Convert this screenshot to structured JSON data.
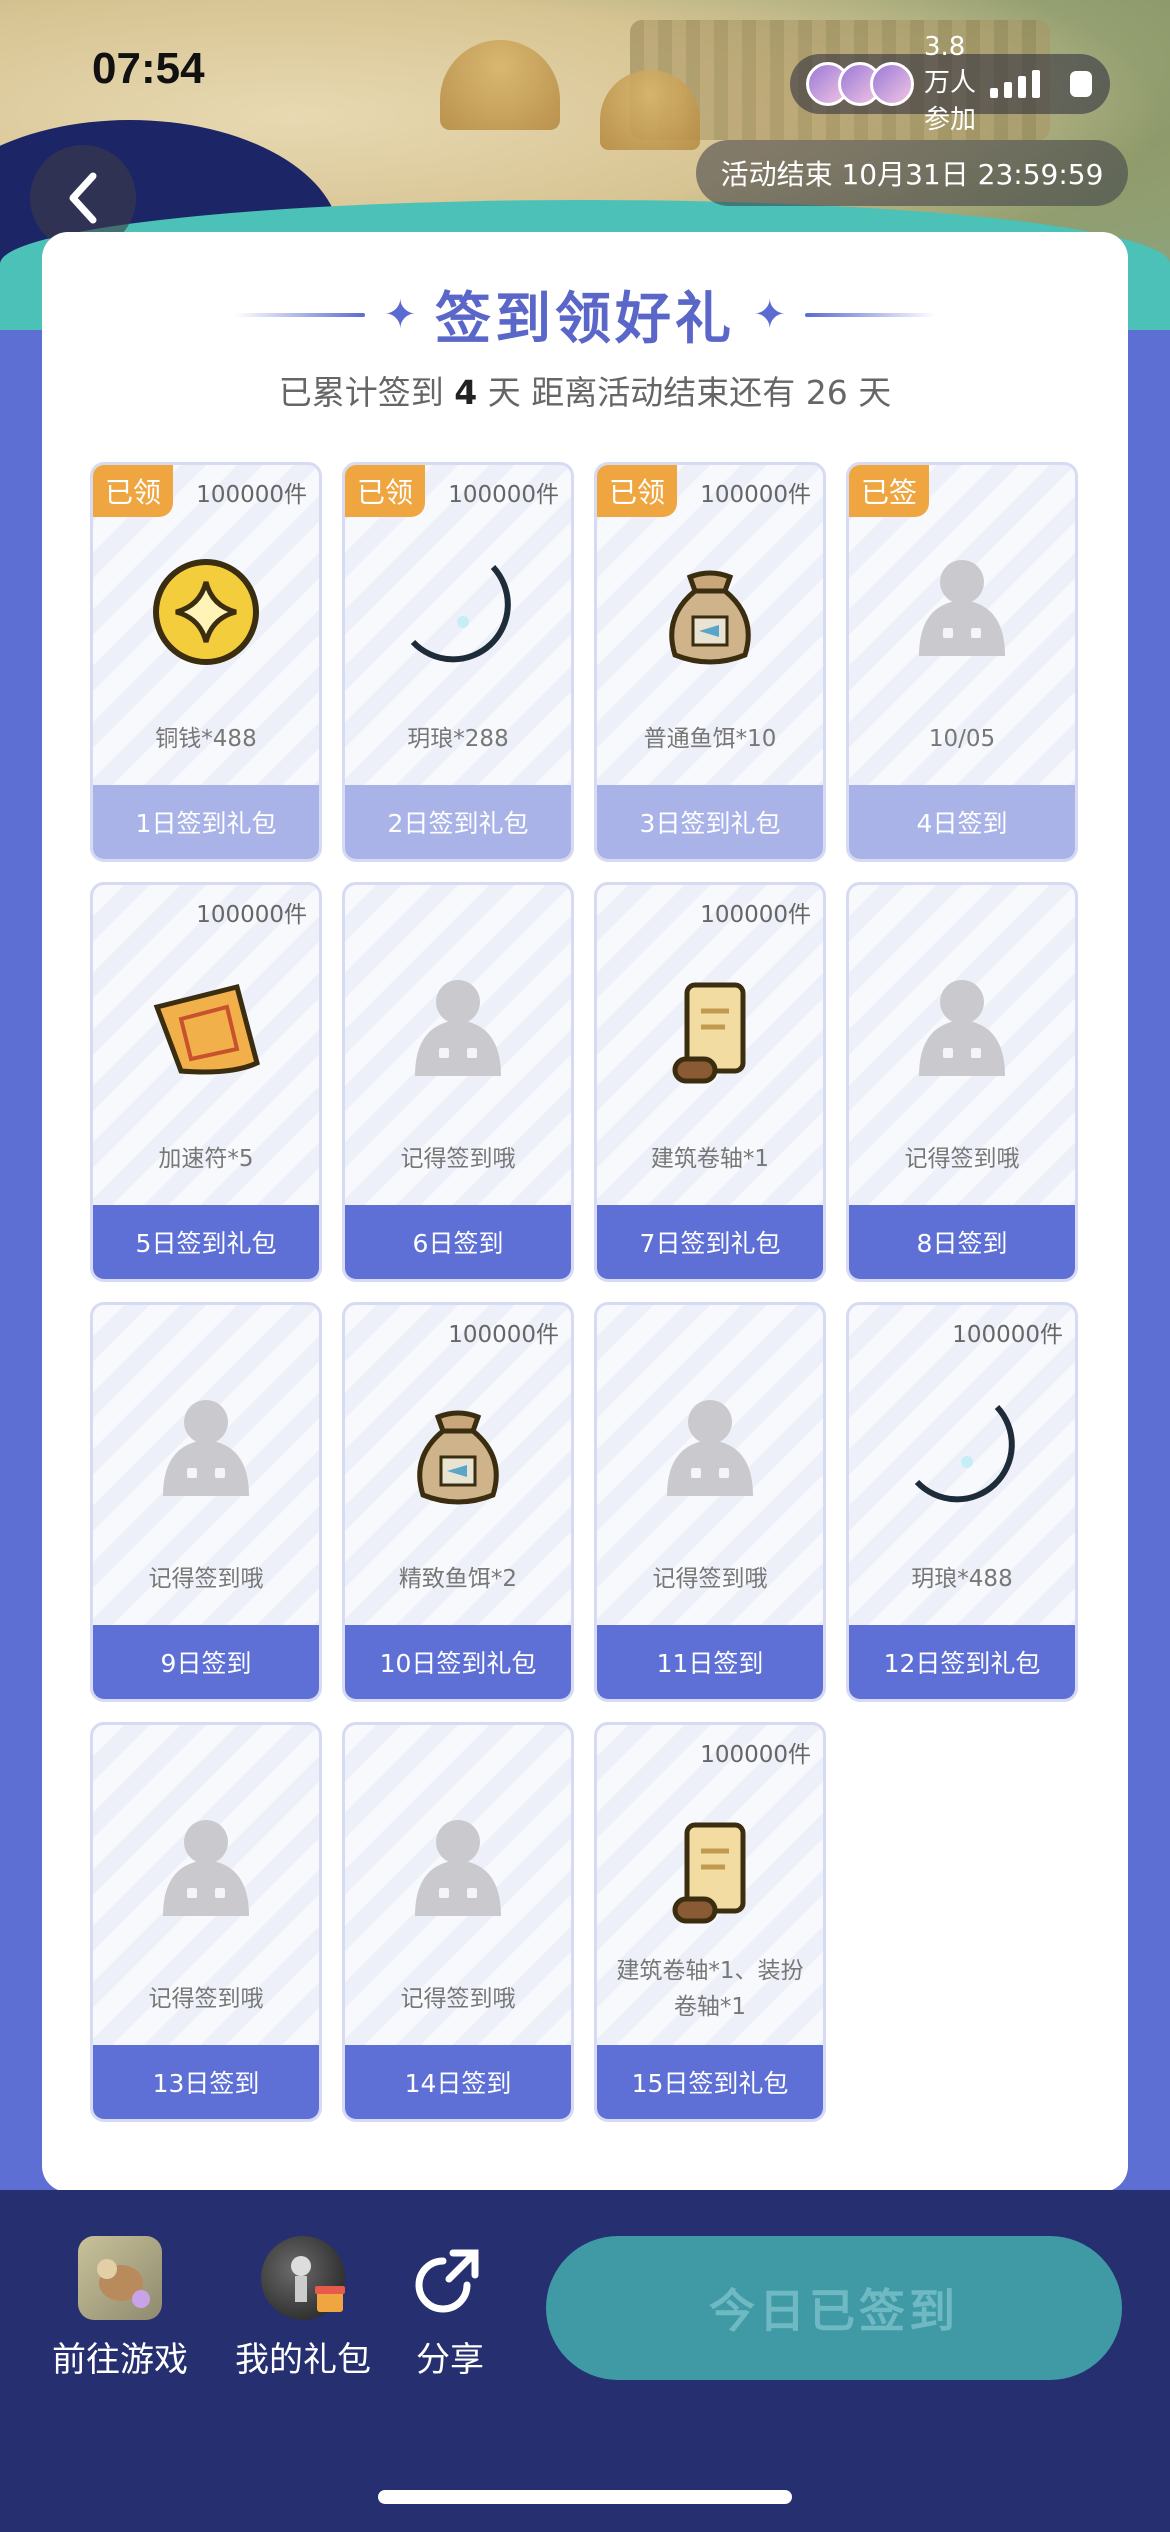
{
  "status_bar": {
    "time": "07:54",
    "participants": "3.8万人参加"
  },
  "header": {
    "activity_end": "活动结束 10月31日 23:59:59"
  },
  "card": {
    "title": "签到领好礼",
    "subtitle_prefix": "已累计签到",
    "signed_days": "4",
    "subtitle_mid": "天  距离活动结束还有 26 天"
  },
  "tiles": [
    {
      "badge": "已领",
      "count": "100000件",
      "name": "铜钱*488",
      "footer": "1日签到礼包",
      "icon": "coin-icon"
    },
    {
      "badge": "已领",
      "count": "100000件",
      "name": "玥琅*288",
      "footer": "2日签到礼包",
      "icon": "crescent-gem-icon"
    },
    {
      "badge": "已领",
      "count": "100000件",
      "name": "普通鱼饵*10",
      "footer": "3日签到礼包",
      "icon": "bait-bag-icon"
    },
    {
      "badge": "已签",
      "count": "",
      "name": "10/05",
      "footer": "4日签到",
      "icon": "placeholder-figure-icon"
    },
    {
      "badge": "",
      "count": "100000件",
      "name": "加速符*5",
      "footer": "5日签到礼包",
      "icon": "talisman-icon"
    },
    {
      "badge": "",
      "count": "",
      "name": "记得签到哦",
      "footer": "6日签到",
      "icon": "placeholder-figure-icon"
    },
    {
      "badge": "",
      "count": "100000件",
      "name": "建筑卷轴*1",
      "footer": "7日签到礼包",
      "icon": "scroll-icon"
    },
    {
      "badge": "",
      "count": "",
      "name": "记得签到哦",
      "footer": "8日签到",
      "icon": "placeholder-figure-icon"
    },
    {
      "badge": "",
      "count": "",
      "name": "记得签到哦",
      "footer": "9日签到",
      "icon": "placeholder-figure-icon"
    },
    {
      "badge": "",
      "count": "100000件",
      "name": "精致鱼饵*2",
      "footer": "10日签到礼包",
      "icon": "bait-bag-icon"
    },
    {
      "badge": "",
      "count": "",
      "name": "记得签到哦",
      "footer": "11日签到",
      "icon": "placeholder-figure-icon"
    },
    {
      "badge": "",
      "count": "100000件",
      "name": "玥琅*488",
      "footer": "12日签到礼包",
      "icon": "crescent-gem-icon"
    },
    {
      "badge": "",
      "count": "",
      "name": "记得签到哦",
      "footer": "13日签到",
      "icon": "placeholder-figure-icon"
    },
    {
      "badge": "",
      "count": "",
      "name": "记得签到哦",
      "footer": "14日签到",
      "icon": "placeholder-figure-icon"
    },
    {
      "badge": "",
      "count": "100000件",
      "name": "建筑卷轴*1、装扮卷轴*1",
      "footer": "15日签到礼包",
      "icon": "scroll-icon"
    }
  ],
  "bottom_bar": {
    "game_label": "前往游戏",
    "gift_label": "我的礼包",
    "share_label": "分享",
    "signed_button": "今日已签到"
  },
  "colors": {
    "accent": "#5e70d6",
    "badge": "#f0a640",
    "bottom": "#262f6f",
    "signed_btn": "#3f9aa6"
  }
}
